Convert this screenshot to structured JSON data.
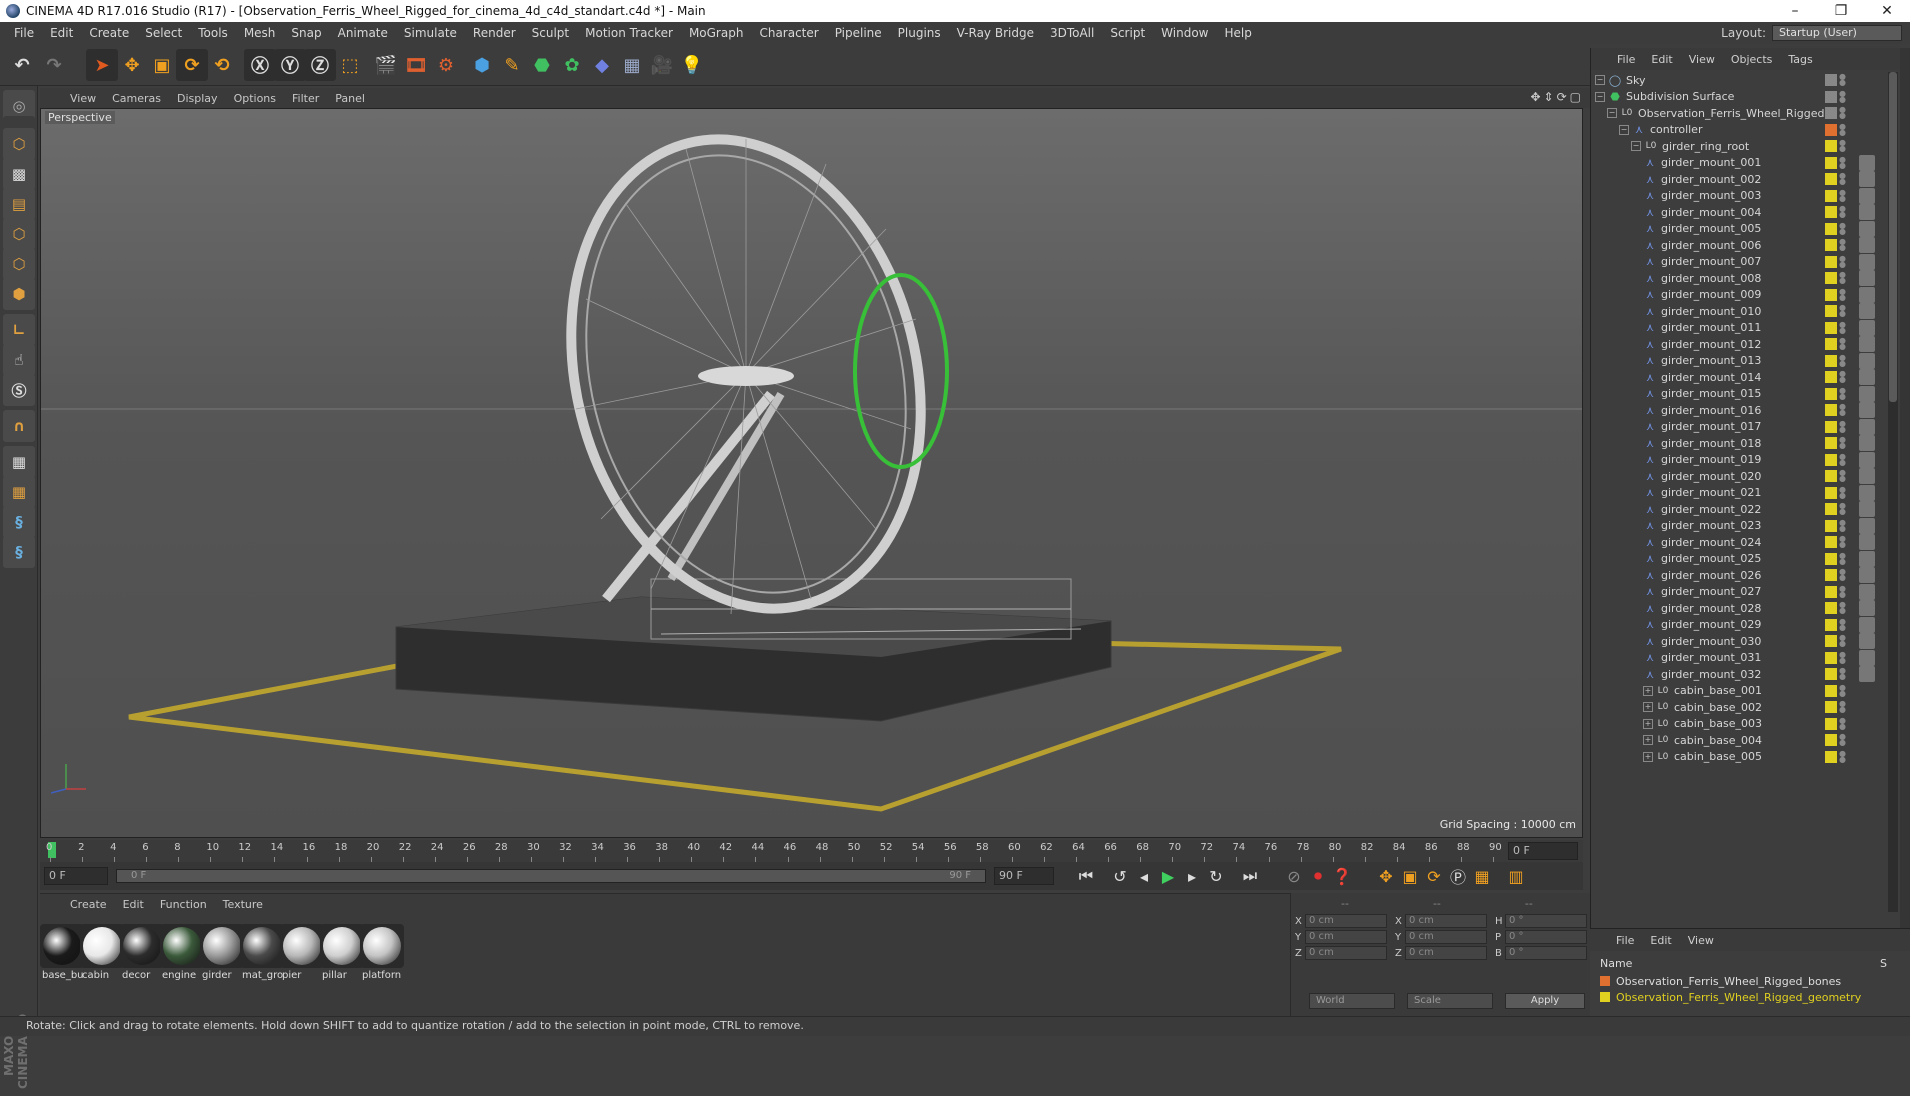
{
  "window": {
    "title": "CINEMA 4D R17.016 Studio (R17) - [Observation_Ferris_Wheel_Rigged_for_cinema_4d_c4d_standart.c4d *] - Main",
    "min": "–",
    "max": "❐",
    "close": "✕"
  },
  "menubar": [
    "File",
    "Edit",
    "Create",
    "Select",
    "Tools",
    "Mesh",
    "Snap",
    "Animate",
    "Simulate",
    "Render",
    "Sculpt",
    "Motion Tracker",
    "MoGraph",
    "Character",
    "Pipeline",
    "Plugins",
    "V-Ray Bridge",
    "3DToAll",
    "Script",
    "Window",
    "Help"
  ],
  "layout": {
    "label": "Layout:",
    "value": "Startup (User)"
  },
  "viewport": {
    "menu": [
      "View",
      "Cameras",
      "Display",
      "Options",
      "Filter",
      "Panel"
    ],
    "label": "Perspective",
    "grid_spacing": "Grid Spacing : 10000 cm"
  },
  "timeline": {
    "ticks": [
      "0",
      "2",
      "4",
      "6",
      "8",
      "10",
      "12",
      "14",
      "16",
      "18",
      "20",
      "22",
      "24",
      "26",
      "28",
      "30",
      "32",
      "34",
      "36",
      "38",
      "40",
      "42",
      "44",
      "46",
      "48",
      "50",
      "52",
      "54",
      "56",
      "58",
      "60",
      "62",
      "64",
      "66",
      "68",
      "70",
      "72",
      "74",
      "76",
      "78",
      "80",
      "82",
      "84",
      "86",
      "88",
      "90"
    ],
    "end_label": "0 F",
    "current_frame": "0 F",
    "range_start": "0 F",
    "range_end": "90 F",
    "max_frame": "90 F"
  },
  "materials": {
    "menu": [
      "Create",
      "Edit",
      "Function",
      "Texture"
    ],
    "items": [
      {
        "name": "base_bu",
        "color": "#1a1a1a"
      },
      {
        "name": "cabin",
        "color": "#e8e8e8"
      },
      {
        "name": "decor",
        "color": "#2c2c2c"
      },
      {
        "name": "engine",
        "color": "#3b5a3b"
      },
      {
        "name": "girder",
        "color": "#9a9a9a"
      },
      {
        "name": "mat_gro",
        "color": "#4a4a4a"
      },
      {
        "name": "pier",
        "color": "#b8b8b8"
      },
      {
        "name": "pillar",
        "color": "#cfcfcf"
      },
      {
        "name": "platforn",
        "color": "#c4c4c4"
      }
    ]
  },
  "coords": {
    "header": [
      "--",
      "--",
      "--"
    ],
    "rows": [
      {
        "a": "X",
        "av": "0 cm",
        "b": "X",
        "bv": "0 cm",
        "c": "H",
        "cv": "0 °"
      },
      {
        "a": "Y",
        "av": "0 cm",
        "b": "Y",
        "bv": "0 cm",
        "c": "P",
        "cv": "0 °"
      },
      {
        "a": "Z",
        "av": "0 cm",
        "b": "Z",
        "bv": "0 cm",
        "c": "B",
        "cv": "0 °"
      }
    ],
    "world": "World",
    "scale": "Scale",
    "apply": "Apply"
  },
  "objects": {
    "menu": [
      "File",
      "Edit",
      "View",
      "Objects",
      "Tags"
    ],
    "rows": [
      {
        "name": "Sky",
        "indent": 0,
        "icon": "sky"
      },
      {
        "name": "Subdivision Surface",
        "indent": 0,
        "icon": "subd"
      },
      {
        "name": "Observation_Ferris_Wheel_Rigged",
        "indent": 1,
        "icon": "null"
      },
      {
        "name": "controller",
        "indent": 2,
        "icon": "joint"
      },
      {
        "name": "girder_ring_root",
        "indent": 3,
        "icon": "null"
      },
      {
        "name": "girder_mount_001",
        "indent": 4,
        "icon": "joint"
      },
      {
        "name": "girder_mount_002",
        "indent": 4,
        "icon": "joint"
      },
      {
        "name": "girder_mount_003",
        "indent": 4,
        "icon": "joint"
      },
      {
        "name": "girder_mount_004",
        "indent": 4,
        "icon": "joint"
      },
      {
        "name": "girder_mount_005",
        "indent": 4,
        "icon": "joint"
      },
      {
        "name": "girder_mount_006",
        "indent": 4,
        "icon": "joint"
      },
      {
        "name": "girder_mount_007",
        "indent": 4,
        "icon": "joint"
      },
      {
        "name": "girder_mount_008",
        "indent": 4,
        "icon": "joint"
      },
      {
        "name": "girder_mount_009",
        "indent": 4,
        "icon": "joint"
      },
      {
        "name": "girder_mount_010",
        "indent": 4,
        "icon": "joint"
      },
      {
        "name": "girder_mount_011",
        "indent": 4,
        "icon": "joint"
      },
      {
        "name": "girder_mount_012",
        "indent": 4,
        "icon": "joint"
      },
      {
        "name": "girder_mount_013",
        "indent": 4,
        "icon": "joint"
      },
      {
        "name": "girder_mount_014",
        "indent": 4,
        "icon": "joint"
      },
      {
        "name": "girder_mount_015",
        "indent": 4,
        "icon": "joint"
      },
      {
        "name": "girder_mount_016",
        "indent": 4,
        "icon": "joint"
      },
      {
        "name": "girder_mount_017",
        "indent": 4,
        "icon": "joint"
      },
      {
        "name": "girder_mount_018",
        "indent": 4,
        "icon": "joint"
      },
      {
        "name": "girder_mount_019",
        "indent": 4,
        "icon": "joint"
      },
      {
        "name": "girder_mount_020",
        "indent": 4,
        "icon": "joint"
      },
      {
        "name": "girder_mount_021",
        "indent": 4,
        "icon": "joint"
      },
      {
        "name": "girder_mount_022",
        "indent": 4,
        "icon": "joint"
      },
      {
        "name": "girder_mount_023",
        "indent": 4,
        "icon": "joint"
      },
      {
        "name": "girder_mount_024",
        "indent": 4,
        "icon": "joint"
      },
      {
        "name": "girder_mount_025",
        "indent": 4,
        "icon": "joint"
      },
      {
        "name": "girder_mount_026",
        "indent": 4,
        "icon": "joint"
      },
      {
        "name": "girder_mount_027",
        "indent": 4,
        "icon": "joint"
      },
      {
        "name": "girder_mount_028",
        "indent": 4,
        "icon": "joint"
      },
      {
        "name": "girder_mount_029",
        "indent": 4,
        "icon": "joint"
      },
      {
        "name": "girder_mount_030",
        "indent": 4,
        "icon": "joint"
      },
      {
        "name": "girder_mount_031",
        "indent": 4,
        "icon": "joint"
      },
      {
        "name": "girder_mount_032",
        "indent": 4,
        "icon": "joint"
      },
      {
        "name": "cabin_base_001",
        "indent": 4,
        "icon": "null"
      },
      {
        "name": "cabin_base_002",
        "indent": 4,
        "icon": "null"
      },
      {
        "name": "cabin_base_003",
        "indent": 4,
        "icon": "null"
      },
      {
        "name": "cabin_base_004",
        "indent": 4,
        "icon": "null"
      },
      {
        "name": "cabin_base_005",
        "indent": 4,
        "icon": "null"
      }
    ]
  },
  "layers": {
    "menu": [
      "File",
      "Edit",
      "View"
    ],
    "header": "Name",
    "header_s": "S",
    "items": [
      {
        "name": "Observation_Ferris_Wheel_Rigged_bones",
        "color": "#e07030"
      },
      {
        "name": "Observation_Ferris_Wheel_Rigged_geometry",
        "color": "#e0d020"
      }
    ]
  },
  "status": "Rotate: Click and drag to rotate elements. Hold down SHIFT to add to quantize rotation / add to the selection in point mode, CTRL to remove."
}
